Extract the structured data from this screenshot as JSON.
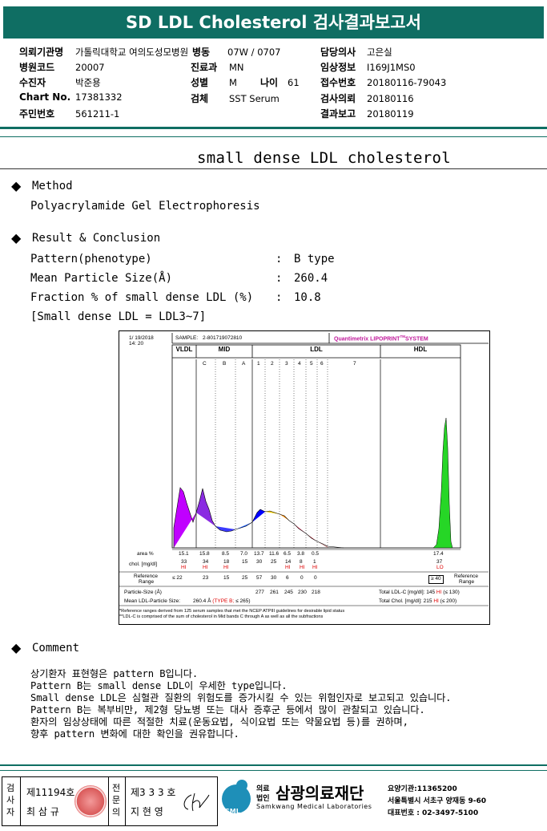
{
  "header": {
    "title": "SD LDL Cholesterol 검사결과보고서"
  },
  "info": {
    "col1": [
      {
        "label": "의뢰기관명",
        "value": "가톨릭대학교 여의도성모병원"
      },
      {
        "label": "병원코드",
        "value": "20007"
      },
      {
        "label": "수진자",
        "value": "박준용"
      },
      {
        "label": "Chart No.",
        "value": "17381332"
      },
      {
        "label": "주민번호",
        "value": "561211-1"
      }
    ],
    "col2": [
      {
        "label": "병동",
        "value": "07W / 0707"
      },
      {
        "label": "진료과",
        "value": "MN"
      },
      {
        "label": "성별",
        "value": "M"
      },
      {
        "label": "검체",
        "value": "SST Serum"
      }
    ],
    "age": {
      "label": "나이",
      "value": "61"
    },
    "col3": [
      {
        "label": "담당의사",
        "value": "고은실"
      },
      {
        "label": "임상정보",
        "value": "I169J1MS0"
      },
      {
        "label": "접수번호",
        "value": "20180116-79043"
      },
      {
        "label": "검사의뢰",
        "value": "20180116"
      },
      {
        "label": "결과보고",
        "value": "20180119"
      }
    ]
  },
  "section_title": "small dense LDL cholesterol",
  "method": {
    "heading": "Method",
    "text": "Polyacrylamide Gel Electrophoresis"
  },
  "result": {
    "heading": "Result & Conclusion",
    "rows": [
      {
        "label": "Pattern(phenotype)",
        "sep": ":",
        "value": "B type"
      },
      {
        "label": "Mean Particle Size(Å)",
        "sep": ":",
        "value": "260.4"
      },
      {
        "label": "Fraction % of small dense LDL (%)",
        "sep": ":",
        "value": "10.8"
      }
    ],
    "note": "[Small dense LDL = LDL3~7]"
  },
  "chart": {
    "date": "1/ 19/2018",
    "time": "14: 20",
    "sample_label": "SAMPLE:",
    "sample_id": "2-801719072810",
    "system": "Quantimetrix LIPOPRINT",
    "system_sup": "TM",
    "system_tail": "SYSTEM",
    "groups": [
      "VLDL",
      "MID",
      "LDL",
      "HDL"
    ],
    "bands": [
      "C",
      "B",
      "A",
      "1",
      "2",
      "3",
      "4",
      "5",
      "6",
      "7"
    ],
    "rows": {
      "area_label": "area %",
      "area": [
        "15.1",
        "15.8",
        "8.5",
        "7.0",
        "13.7",
        "11.6",
        "6.5",
        "3.8",
        "0.5"
      ],
      "area_hdl": "17.4",
      "chol_label": "chol. [mg/dl]",
      "chol": [
        "33",
        "34",
        "18",
        "15",
        "30",
        "25",
        "14",
        "8",
        "1"
      ],
      "chol_hdl": "37",
      "chol_flags": [
        "HI",
        "HI",
        "HI",
        "",
        "",
        "",
        "HI",
        "HI",
        "HI"
      ],
      "hdl_flag": "LO",
      "ref_label1": "Reference",
      "ref_label2": "Range",
      "ref": [
        "≤ 22",
        "23",
        "15",
        "25",
        "57",
        "30",
        "6",
        "0",
        "0"
      ],
      "ref_hdl": "≥ 40",
      "ref_right1": "Reference",
      "ref_right2": "Range",
      "ps_label": "Particle-Size (Å)",
      "ps": [
        "277",
        "261",
        "245",
        "230",
        "218"
      ],
      "mean_label": "Mean LDL-Particle Size:",
      "mean_value": "260.4 Å",
      "mean_type": "(TYPE B;",
      "mean_tail": "≤ 265)",
      "tldl_label": "Total LDL-C [mg/dl]:",
      "tldl_value": "145",
      "tldl_flag": "HI",
      "tldl_ref": "(≤ 130)",
      "tchol_label": "Total Chol. [mg/dl]:",
      "tchol_value": "215",
      "tchol_flag": "HI",
      "tchol_ref": "(≤ 200)"
    },
    "foot1": "*Reference ranges derived from 125 serum samples that met the NCEP ATPIII guidelines for desirable lipid status",
    "foot2": "**LDL-C is comprised of the sum of cholesterol in Mid bands C through A as well as all the subfractions"
  },
  "comment": {
    "heading": "Comment",
    "lines": [
      "상기환자 표현형은 pattern B입니다.",
      "Pattern B는 small dense LDL이 우세한 type입니다.",
      "Small dense LDL은 심혈관 질환의 위험도를 증가시킬 수 있는 위험인자로 보고되고 있습니다.",
      "Pattern B는 복부비만, 제2형 당뇨병 또는 대사 증후군 등에서 많이 관찰되고 있습니다.",
      "환자의 임상상태에 따른 적절한 치료(운동요법, 식이요법 또는 약물요법 등)를 권하며,",
      "향후 pattern 변화에 대한 확인을 권유합니다."
    ]
  },
  "footer": {
    "tester_label": "검사자",
    "tester_no": "제11194호",
    "tester_name": "최 삼 규",
    "expert_label": "전문의",
    "expert_no": "제3 3 3 호",
    "expert_name": "지 현 영",
    "logo_text": "SML",
    "org_prefix1": "의료",
    "org_prefix2": "법인",
    "org_name": "삼광의료재단",
    "org_eng": "Samkwang Medical Laboratories",
    "code_line": "요양기관:11365200",
    "addr_line": "서울특별시 서초구 양재동 9-60",
    "tel_line": "대표번호 : 02-3497-5100"
  }
}
